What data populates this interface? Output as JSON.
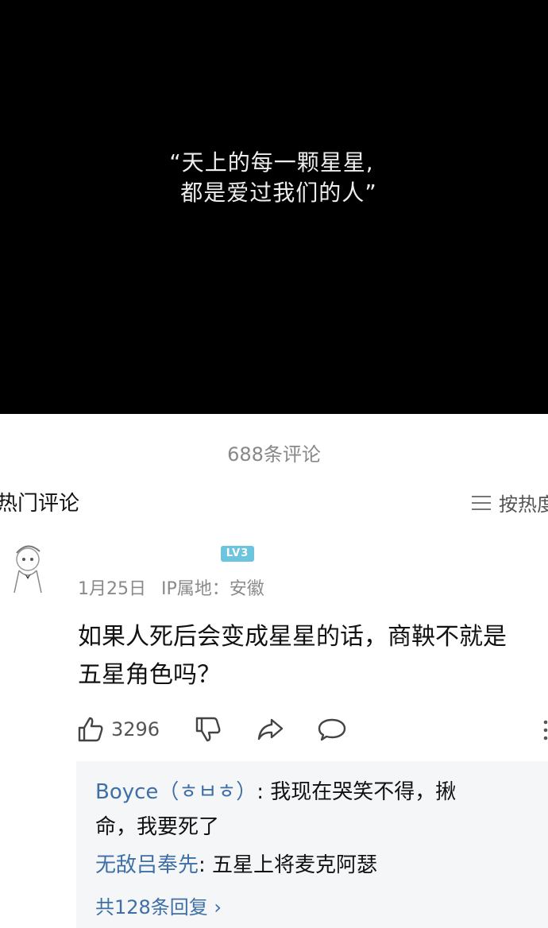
{
  "video": {
    "quote_line1": "“天上的每一颗星星,",
    "quote_line2": "都是爱过我们的人”"
  },
  "comments_count": "688条评论",
  "section_title": "热门评论",
  "sort_label": "按热度",
  "comment": {
    "level_badge": "LV3",
    "date": "1月25日",
    "ip": "IP属地：安徽",
    "text_line1": "如果人死后会变成星星的话，商鞅不就是",
    "text_line2": "五星角色吗？",
    "like_count": "3296",
    "replies": [
      {
        "user": "Boyce（ㅎㅂㅎ）",
        "text_line1": ": 我现在哭笑不得，揪",
        "text_line2": "命，我要死了"
      },
      {
        "user": "无敌吕奉先",
        "text_line1": ": 五星上将麦克阿瑟"
      }
    ],
    "more_replies": "共128条回复 ›"
  },
  "colors": {
    "video_bg": "#000000",
    "username": "#3e6fa6",
    "reply_bg": "#f5f6f8",
    "level_badge": "#6cc4de"
  }
}
